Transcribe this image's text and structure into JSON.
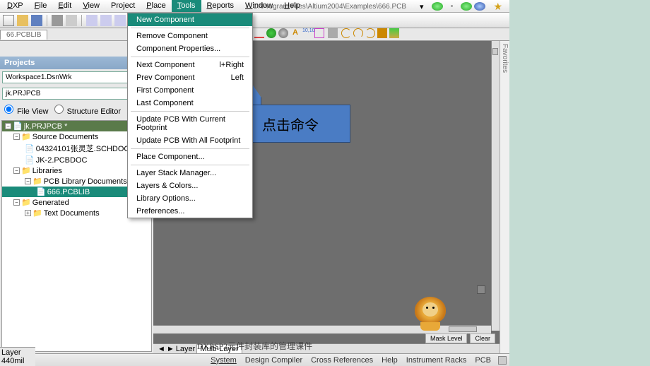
{
  "menu": {
    "items": [
      "DXP",
      "File",
      "Edit",
      "View",
      "Project",
      "Place",
      "Tools",
      "Reports",
      "Window",
      "Help"
    ],
    "underlines": [
      "D",
      "F",
      "E",
      "V",
      "C",
      "P",
      "T",
      "R",
      "W",
      "H"
    ]
  },
  "path": "C:\\Program Files\\Altium2004\\Examples\\666.PCB",
  "tab": "66.PCBLIB",
  "projects": {
    "title": "Projects",
    "workspace": "Workspace1.DsnWrk",
    "project": "jk.PRJPCB",
    "fileview": "File View",
    "structed": "Structure Editor",
    "tree": {
      "root": "jk.PRJPCB *",
      "src": "Source Documents",
      "src_items": [
        "04324101张灵芝.SCHDOC",
        "JK-2.PCBDOC"
      ],
      "lib": "Libraries",
      "pcblib": "PCB Library Documents",
      "pcblib_sel": "666.PCBLIB",
      "gen": "Generated",
      "textdocs": "Text Documents"
    }
  },
  "dropdown": {
    "items": [
      {
        "label": "New Component",
        "hl": true
      },
      {
        "sep": true
      },
      {
        "label": "Remove Component"
      },
      {
        "label": "Component Properties..."
      },
      {
        "sep": true
      },
      {
        "label": "Next Component",
        "shortcut": "l+Right"
      },
      {
        "label": "Prev Component",
        "shortcut": "Left"
      },
      {
        "label": "First Component"
      },
      {
        "label": "Last Component"
      },
      {
        "sep": true
      },
      {
        "label": "Update PCB With Current Footprint"
      },
      {
        "label": "Update PCB With All Footprint"
      },
      {
        "sep": true
      },
      {
        "label": "Place Component..."
      },
      {
        "sep": true
      },
      {
        "label": "Layer Stack Manager..."
      },
      {
        "label": "Layers & Colors..."
      },
      {
        "label": "Library Options..."
      },
      {
        "label": "Preferences..."
      }
    ]
  },
  "callout": "点击命令",
  "layer_tabs": {
    "prefix": "Layer",
    "active": "Multi-Layer"
  },
  "mask": {
    "mask": "Mask Level",
    "clear": "Clear"
  },
  "status": [
    "System",
    "Design Compiler",
    "Cross References",
    "Help",
    "Instrument Racks",
    "PCB"
  ],
  "caption": "DXPSP2元件封装库的管理课件",
  "right_label": "Favorites",
  "corner": {
    "layer": "Layer",
    "coord": "440mil"
  }
}
